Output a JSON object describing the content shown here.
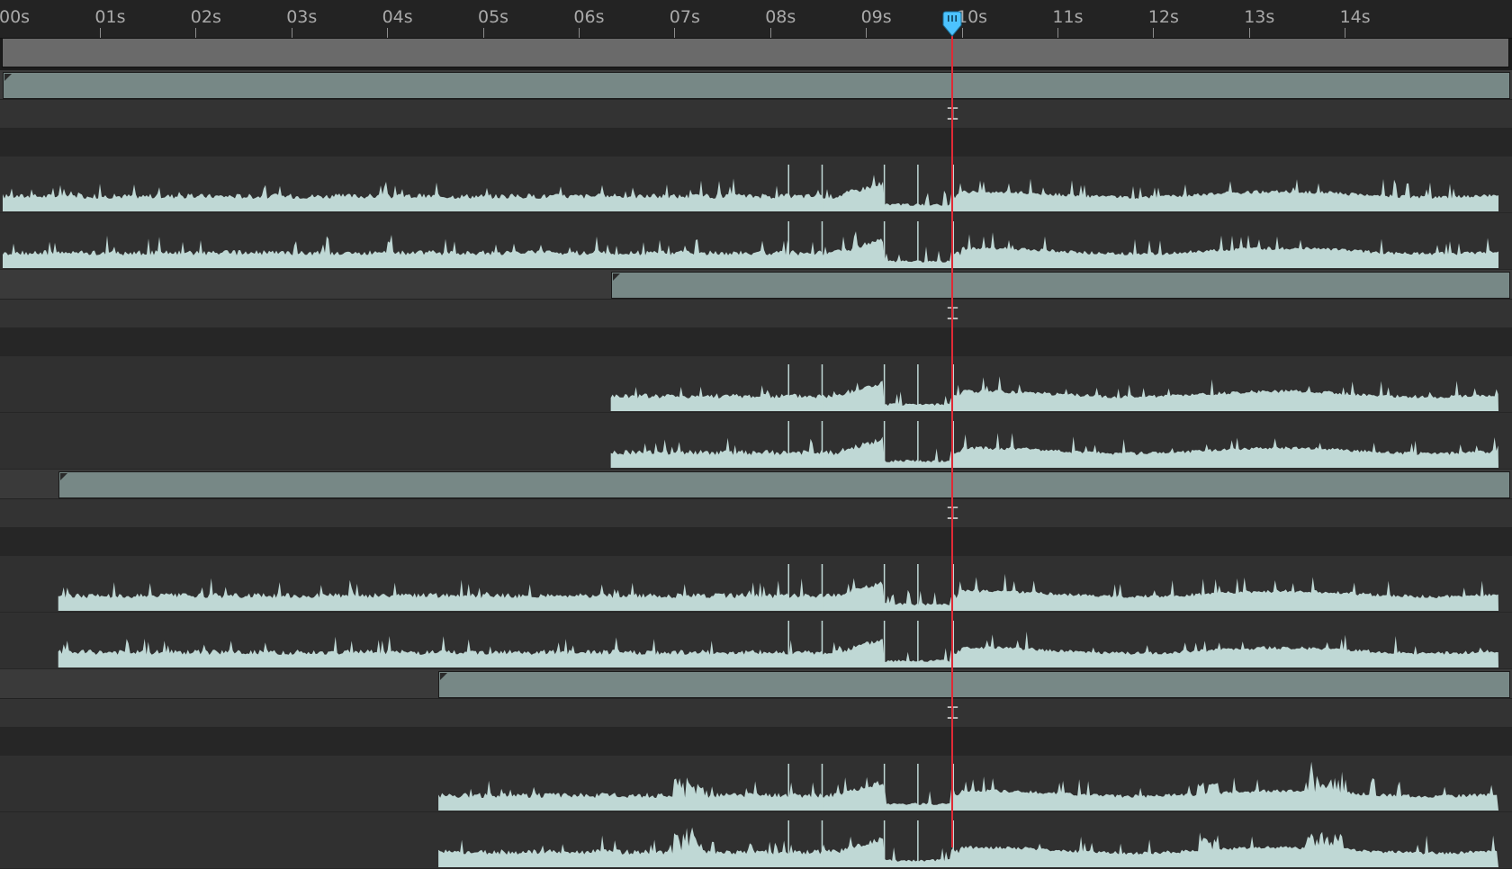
{
  "ruler": {
    "ticks": [
      "00s",
      "01s",
      "02s",
      "03s",
      "04s",
      "05s",
      "06s",
      "07s",
      "08s",
      "09s",
      "10s",
      "11s",
      "12s",
      "13s",
      "14s"
    ]
  },
  "playhead": {
    "time_s": 9.92
  },
  "colors": {
    "waveform": "#bfd8d5",
    "clip_bar": "#778886",
    "playhead": "#e02a36",
    "playhead_handle": "#4cc3ff"
  },
  "icons": {
    "keyframe_marker": "I-beam",
    "playhead_handle": "cti-handle-icon"
  },
  "layers": [
    {
      "start_s": 0.0
    },
    {
      "start_s": 6.35
    },
    {
      "start_s": 0.58
    },
    {
      "start_s": 4.55
    }
  ]
}
